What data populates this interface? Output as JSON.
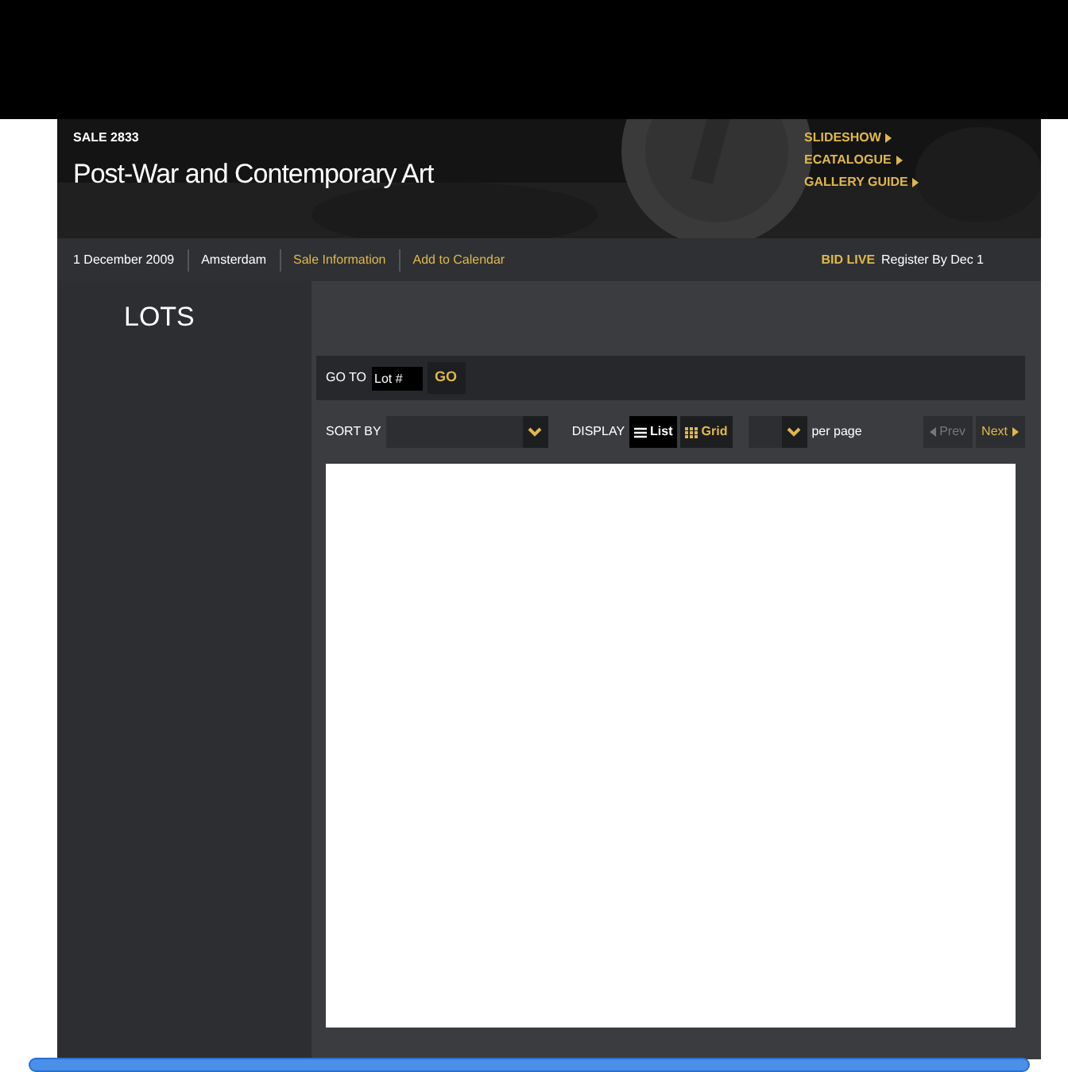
{
  "header": {
    "sale_number": "SALE 2833",
    "title": "Post-War and Contemporary Art",
    "links": [
      {
        "label": "SLIDESHOW"
      },
      {
        "label": "ECATALOGUE"
      },
      {
        "label": "GALLERY GUIDE"
      }
    ]
  },
  "info_bar": {
    "items": [
      {
        "label": "1 December 2009",
        "kind": "text"
      },
      {
        "label": "Amsterdam",
        "kind": "text"
      },
      {
        "label": "Sale Information",
        "kind": "link"
      },
      {
        "label": "Add to Calendar",
        "kind": "link"
      }
    ],
    "bid_live": "BID LIVE",
    "register": "Register By Dec 1"
  },
  "lots": {
    "heading": "LOTS",
    "goto": {
      "label": "GO TO",
      "placeholder": "Lot #",
      "button": "GO"
    },
    "controls": {
      "sort_label": "SORT BY",
      "display_label": "DISPLAY",
      "views": [
        {
          "label": "List",
          "selected": true
        },
        {
          "label": "Grid",
          "selected": false
        }
      ],
      "per_page": "per page",
      "prev": {
        "label": "Prev",
        "disabled": true
      },
      "next": {
        "label": "Next",
        "disabled": false
      }
    }
  }
}
